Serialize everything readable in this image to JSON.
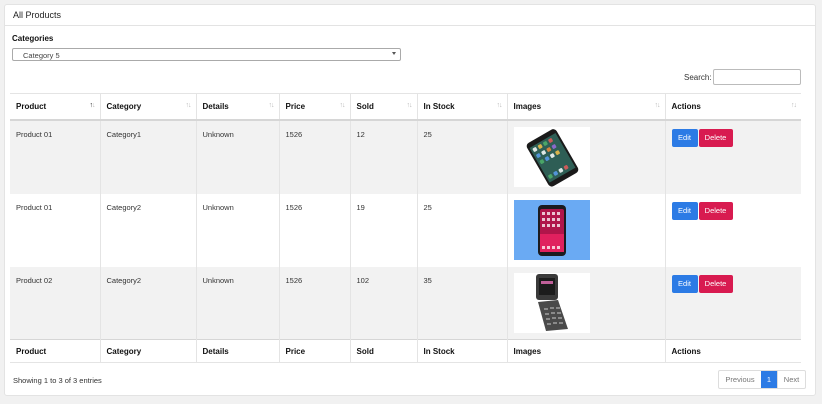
{
  "card": {
    "title": "All Products"
  },
  "filter": {
    "label": "Categories",
    "selected": "Category 5"
  },
  "search": {
    "label": "Search:",
    "value": ""
  },
  "columns": [
    "Product",
    "Category",
    "Details",
    "Price",
    "Sold",
    "In Stock",
    "Images",
    "Actions"
  ],
  "rows": [
    {
      "product": "Product 01",
      "category": "Category1",
      "details": "Unknown",
      "price": "1526",
      "sold": "12",
      "stock": "25",
      "image": "iphone-black-photo"
    },
    {
      "product": "Product 01",
      "category": "Category2",
      "details": "Unknown",
      "price": "1526",
      "sold": "19",
      "stock": "25",
      "image": "iphone-blue-background-photo"
    },
    {
      "product": "Product 02",
      "category": "Category2",
      "details": "Unknown",
      "price": "1526",
      "sold": "102",
      "stock": "35",
      "image": "flip-phone-photo"
    }
  ],
  "actions": {
    "edit": "Edit",
    "delete": "Delete"
  },
  "footer": {
    "info": "Showing 1 to 3 of 3 entries"
  },
  "pagination": {
    "previous": "Previous",
    "current": "1",
    "next": "Next"
  },
  "colors": {
    "primary": "#2c7be5",
    "danger": "#d81b50",
    "stripe": "#f2f2f2"
  }
}
